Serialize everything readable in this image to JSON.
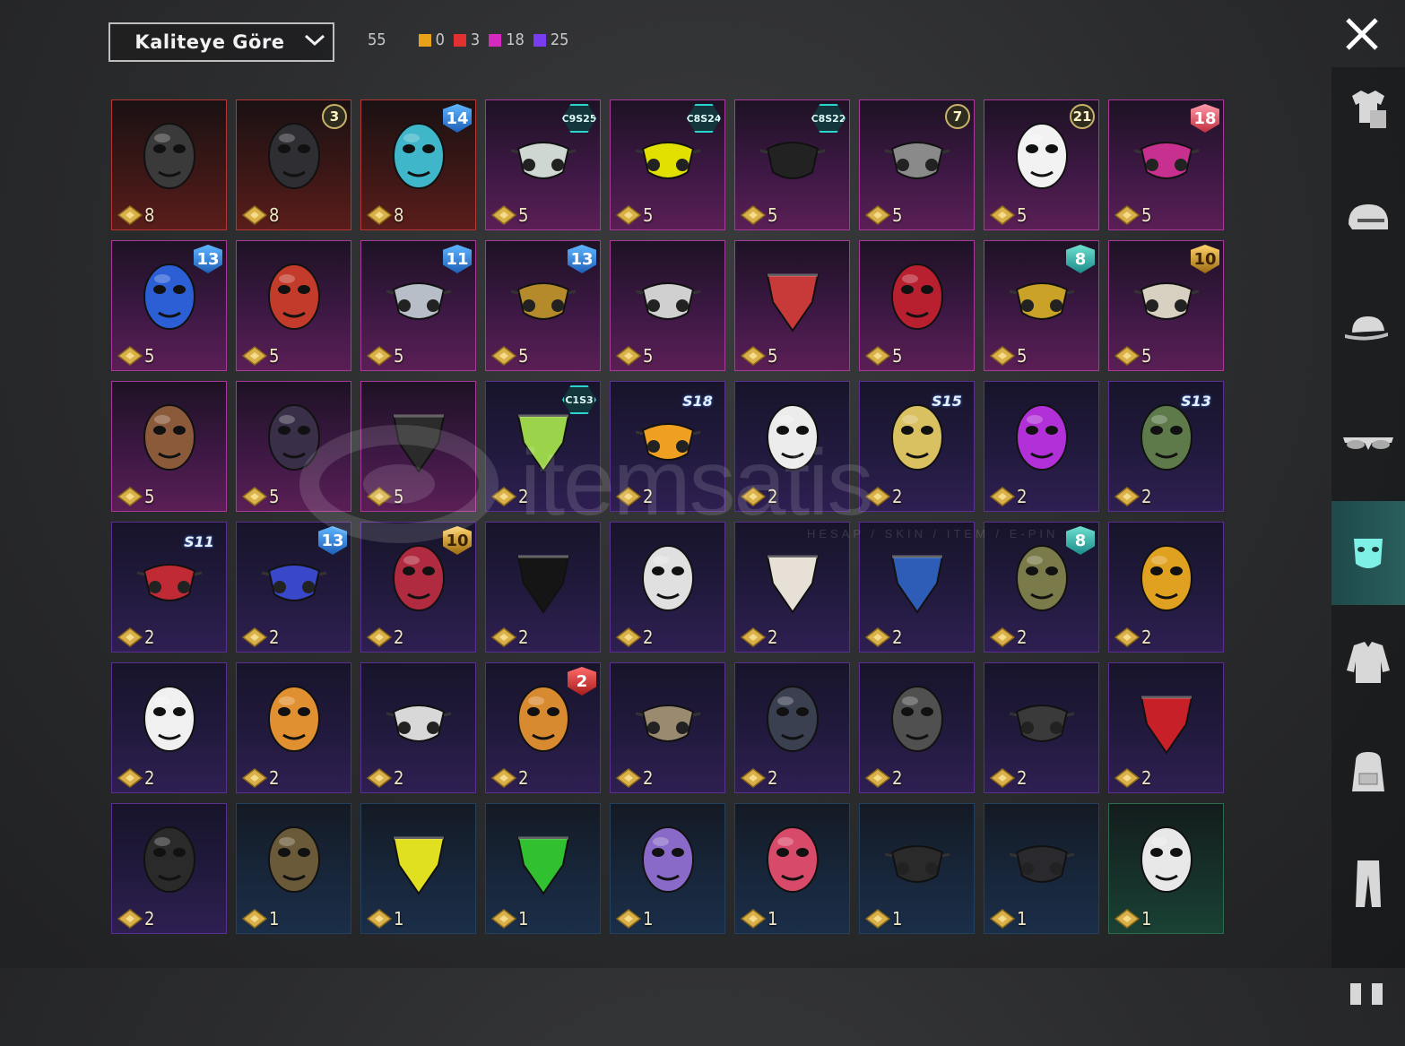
{
  "toolbar": {
    "sort_label": "Kaliteye Göre",
    "total_count": "55",
    "rarity_counts": [
      {
        "color": "#e8a21a",
        "count": "0"
      },
      {
        "color": "#e33030",
        "count": "3"
      },
      {
        "color": "#d42ac0",
        "count": "18"
      },
      {
        "color": "#7a3cf0",
        "count": "25"
      }
    ]
  },
  "watermark": {
    "text": "itemsatis",
    "sub": "HESAP / SKIN / ITEM / E-PIN"
  },
  "sidebar": {
    "items": [
      {
        "icon": "outfit-icon"
      },
      {
        "icon": "helmet-icon"
      },
      {
        "icon": "cap-icon"
      },
      {
        "icon": "glasses-icon"
      },
      {
        "icon": "mask-icon",
        "active": true
      },
      {
        "icon": "jacket-icon"
      },
      {
        "icon": "backpack-icon"
      },
      {
        "icon": "pants-icon"
      },
      {
        "icon": "shoes-icon"
      }
    ]
  },
  "items": [
    {
      "rarity": "red",
      "qty": "8",
      "badge": null,
      "icon": "cyber-helmet-mask-icon",
      "color": "#3a3a3a"
    },
    {
      "rarity": "red",
      "qty": "8",
      "badge": {
        "type": "lvl",
        "text": "3"
      },
      "icon": "wolf-mask-icon",
      "color": "#2e2e33"
    },
    {
      "rarity": "red",
      "qty": "8",
      "badge": {
        "type": "shield",
        "tone": "blue",
        "text": "14"
      },
      "icon": "cyan-helmet-mask-icon",
      "color": "#3fb6c9"
    },
    {
      "rarity": "pink",
      "qty": "5",
      "badge": {
        "type": "hex",
        "text": "C9S25"
      },
      "icon": "tech-mouth-mask-icon",
      "color": "#cfd7d2"
    },
    {
      "rarity": "pink",
      "qty": "5",
      "badge": {
        "type": "hex",
        "text": "C8S24"
      },
      "icon": "neon-visor-icon",
      "color": "#e2e000"
    },
    {
      "rarity": "pink",
      "qty": "5",
      "badge": {
        "type": "hex",
        "text": "C8S22"
      },
      "icon": "black-respirator-icon",
      "color": "#222222"
    },
    {
      "rarity": "pink",
      "qty": "5",
      "badge": {
        "type": "lvl",
        "text": "7"
      },
      "icon": "headset-mic-icon",
      "color": "#8a8a8a"
    },
    {
      "rarity": "pink",
      "qty": "5",
      "badge": {
        "type": "lvl",
        "text": "21"
      },
      "icon": "joker-mask-icon",
      "color": "#f2f2f2"
    },
    {
      "rarity": "pink",
      "qty": "5",
      "badge": {
        "type": "shield",
        "tone": "pinkred",
        "text": "18"
      },
      "icon": "pink-face-mask-icon",
      "color": "#c8308f"
    },
    {
      "rarity": "pink",
      "qty": "5",
      "badge": {
        "type": "shield",
        "tone": "blue",
        "text": "13"
      },
      "icon": "blue-half-mask-icon",
      "color": "#2c5fd6"
    },
    {
      "rarity": "pink",
      "qty": "5",
      "badge": null,
      "icon": "red-bird-mask-icon",
      "color": "#c33b2a"
    },
    {
      "rarity": "pink",
      "qty": "5",
      "badge": {
        "type": "shield",
        "tone": "blue",
        "text": "11"
      },
      "icon": "silver-respirator-icon",
      "color": "#b8bec8"
    },
    {
      "rarity": "pink",
      "qty": "5",
      "badge": {
        "type": "shield",
        "tone": "blue",
        "text": "13"
      },
      "icon": "gold-gas-mask-icon",
      "color": "#b58a2a"
    },
    {
      "rarity": "pink",
      "qty": "5",
      "badge": null,
      "icon": "breathing-tube-icon",
      "color": "#d0d0d0"
    },
    {
      "rarity": "pink",
      "qty": "5",
      "badge": null,
      "icon": "skull-bandana-icon",
      "color": "#c83a3a"
    },
    {
      "rarity": "pink",
      "qty": "5",
      "badge": null,
      "icon": "red-skull-mask-icon",
      "color": "#b82030"
    },
    {
      "rarity": "pink",
      "qty": "5",
      "badge": {
        "type": "shield",
        "tone": "teal",
        "text": "8"
      },
      "icon": "gold-gas-helmet-icon",
      "color": "#c9a227"
    },
    {
      "rarity": "pink",
      "qty": "5",
      "badge": {
        "type": "shield",
        "tone": "gold",
        "text": "10"
      },
      "icon": "skull-respirator-icon",
      "color": "#d8d0c0"
    },
    {
      "rarity": "pink",
      "qty": "5",
      "badge": null,
      "icon": "plague-beak-mask-icon",
      "color": "#8a5a3a"
    },
    {
      "rarity": "pink",
      "qty": "5",
      "badge": null,
      "icon": "dark-helmet-mask-icon",
      "color": "#3a2f48"
    },
    {
      "rarity": "pink",
      "qty": "5",
      "badge": null,
      "icon": "skull-balaclava-icon",
      "color": "#2b2b2b"
    },
    {
      "rarity": "purple",
      "qty": "2",
      "badge": {
        "type": "hex",
        "text": "C1S3"
      },
      "icon": "cactus-bandana-icon",
      "color": "#9bd44a"
    },
    {
      "rarity": "purple",
      "qty": "2",
      "badge": {
        "type": "season",
        "text": "S18"
      },
      "icon": "neon-mouth-guard-icon",
      "color": "#f0a020"
    },
    {
      "rarity": "purple",
      "qty": "2",
      "badge": null,
      "icon": "white-eye-mask-icon",
      "color": "#ececec"
    },
    {
      "rarity": "purple",
      "qty": "2",
      "badge": {
        "type": "season",
        "text": "S15"
      },
      "icon": "horned-skull-mask-icon",
      "color": "#d9c060"
    },
    {
      "rarity": "purple",
      "qty": "2",
      "badge": null,
      "icon": "purple-goggle-mask-icon",
      "color": "#b230d8"
    },
    {
      "rarity": "purple",
      "qty": "2",
      "badge": {
        "type": "season",
        "text": "S13"
      },
      "icon": "aviator-goggle-cap-icon",
      "color": "#5e7a4a"
    },
    {
      "rarity": "purple",
      "qty": "2",
      "badge": {
        "type": "season",
        "text": "S11"
      },
      "icon": "red-mouth-guard-icon",
      "color": "#c02a35"
    },
    {
      "rarity": "purple",
      "qty": "2",
      "badge": {
        "type": "shield",
        "tone": "blue",
        "text": "13"
      },
      "icon": "blue-gas-mask-icon",
      "color": "#3848c8"
    },
    {
      "rarity": "purple",
      "qty": "2",
      "badge": {
        "type": "shield",
        "tone": "gold",
        "text": "10"
      },
      "icon": "red-grin-mask-icon",
      "color": "#b02a40"
    },
    {
      "rarity": "purple",
      "qty": "2",
      "badge": null,
      "icon": "black-balaclava-icon",
      "color": "#151515"
    },
    {
      "rarity": "purple",
      "qty": "2",
      "badge": null,
      "icon": "bandage-mask-icon",
      "color": "#e0e0e0"
    },
    {
      "rarity": "purple",
      "qty": "2",
      "badge": null,
      "icon": "white-bandana-icon",
      "color": "#e6e0d6"
    },
    {
      "rarity": "purple",
      "qty": "2",
      "badge": null,
      "icon": "blue-bandana-icon",
      "color": "#2e5db8"
    },
    {
      "rarity": "purple",
      "qty": "2",
      "badge": {
        "type": "shield",
        "tone": "teal",
        "text": "8"
      },
      "icon": "camo-hockey-mask-icon",
      "color": "#7a7a4a"
    },
    {
      "rarity": "purple",
      "qty": "2",
      "badge": null,
      "icon": "yellow-spiked-mask-icon",
      "color": "#e0a020"
    },
    {
      "rarity": "purple",
      "qty": "2",
      "badge": null,
      "icon": "white-fang-mask-icon",
      "color": "#f0f0f0"
    },
    {
      "rarity": "purple",
      "qty": "2",
      "badge": null,
      "icon": "orange-hockey-mask-icon",
      "color": "#e09030"
    },
    {
      "rarity": "purple",
      "qty": "2",
      "badge": null,
      "icon": "cloth-face-mask-icon",
      "color": "#d8d8d8"
    },
    {
      "rarity": "purple",
      "qty": "2",
      "badge": {
        "type": "shield",
        "tone": "red",
        "text": "2"
      },
      "icon": "orange-grin-mask-icon",
      "color": "#d88a30"
    },
    {
      "rarity": "purple",
      "qty": "2",
      "badge": null,
      "icon": "rusty-gas-mask-icon",
      "color": "#9a8a70"
    },
    {
      "rarity": "purple",
      "qty": "2",
      "badge": null,
      "icon": "dark-skull-mask-icon",
      "color": "#3a4050"
    },
    {
      "rarity": "purple",
      "qty": "2",
      "badge": null,
      "icon": "metal-jaw-mask-icon",
      "color": "#505050"
    },
    {
      "rarity": "purple",
      "qty": "2",
      "badge": null,
      "icon": "iron-muzzle-mask-icon",
      "color": "#3a3a3a"
    },
    {
      "rarity": "purple",
      "qty": "2",
      "badge": null,
      "icon": "red-neckerchief-icon",
      "color": "#c82028"
    },
    {
      "rarity": "purple",
      "qty": "2",
      "badge": null,
      "icon": "black-riot-mask-icon",
      "color": "#2a2a2a"
    },
    {
      "rarity": "blue",
      "qty": "1",
      "badge": null,
      "icon": "rusty-hockey-mask-icon",
      "color": "#6a5a3a"
    },
    {
      "rarity": "blue",
      "qty": "1",
      "badge": null,
      "icon": "yellow-dot-bandana-icon",
      "color": "#e0e020"
    },
    {
      "rarity": "blue",
      "qty": "1",
      "badge": null,
      "icon": "spiderweb-bandana-icon",
      "color": "#30c030"
    },
    {
      "rarity": "blue",
      "qty": "1",
      "badge": null,
      "icon": "purple-theater-mask-icon",
      "color": "#8a6ac8"
    },
    {
      "rarity": "blue",
      "qty": "1",
      "badge": null,
      "icon": "red-theater-mask-icon",
      "color": "#d84a6a"
    },
    {
      "rarity": "blue",
      "qty": "1",
      "badge": null,
      "icon": "gold-emblem-face-mask-icon",
      "color": "#2a2a2a"
    },
    {
      "rarity": "blue",
      "qty": "1",
      "badge": null,
      "icon": "half-respirator-icon",
      "color": "#2a2a2e"
    },
    {
      "rarity": "green",
      "qty": "1",
      "badge": null,
      "icon": "white-hockey-mask-icon",
      "color": "#e8e8e8"
    }
  ]
}
